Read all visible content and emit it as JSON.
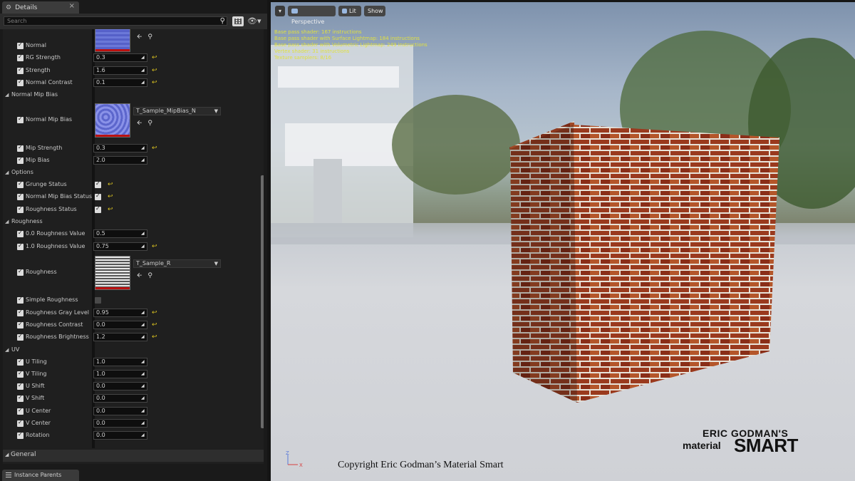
{
  "details_tab": {
    "label": "Details"
  },
  "search": {
    "placeholder": "Search"
  },
  "properties": [
    {
      "type": "texture",
      "name": "Normal",
      "checked": true
    },
    {
      "type": "number",
      "name": "RG Strength",
      "value": "0.3",
      "reset": true
    },
    {
      "type": "number",
      "name": "Strength",
      "value": "1.6",
      "reset": true
    },
    {
      "type": "number",
      "name": "Normal Contrast",
      "value": "0.1",
      "reset": true
    },
    {
      "type": "category",
      "name": "Normal Mip Bias"
    },
    {
      "type": "texture",
      "name": "Normal Mip Bias",
      "texture": "T_Sample_MipBias_N",
      "checked": true
    },
    {
      "type": "number",
      "name": "Mip Strength",
      "value": "0.3",
      "reset": true
    },
    {
      "type": "number",
      "name": "Mip Bias",
      "value": "2.0",
      "reset": false
    },
    {
      "type": "category",
      "name": "Options"
    },
    {
      "type": "bool",
      "name": "Grunge Status",
      "value": true,
      "reset": true
    },
    {
      "type": "bool",
      "name": "Normal Mip Bias Status",
      "value": true,
      "reset": true
    },
    {
      "type": "bool",
      "name": "Roughness Status",
      "value": true,
      "reset": true
    },
    {
      "type": "category",
      "name": "Roughness"
    },
    {
      "type": "number",
      "name": "0.0 Roughness Value",
      "value": "0.5",
      "reset": false
    },
    {
      "type": "number",
      "name": "1.0 Roughness Value",
      "value": "0.75",
      "reset": true
    },
    {
      "type": "texture",
      "name": "Roughness",
      "texture": "T_Sample_R",
      "checked": true
    },
    {
      "type": "bool",
      "name": "Simple Roughness",
      "value": false,
      "reset": false
    },
    {
      "type": "number",
      "name": "Roughness Gray Level",
      "value": "0.95",
      "reset": true
    },
    {
      "type": "number",
      "name": "Roughness Contrast",
      "value": "0.0",
      "reset": true
    },
    {
      "type": "number",
      "name": "Roughness Brightness",
      "value": "1.2",
      "reset": true
    },
    {
      "type": "category",
      "name": "UV"
    },
    {
      "type": "number",
      "name": "U Tiling",
      "value": "1.0",
      "reset": false
    },
    {
      "type": "number",
      "name": "V Tiling",
      "value": "1.0",
      "reset": false
    },
    {
      "type": "number",
      "name": "U Shift",
      "value": "0.0",
      "reset": false
    },
    {
      "type": "number",
      "name": "V Shift",
      "value": "0.0",
      "reset": false
    },
    {
      "type": "number",
      "name": "U Center",
      "value": "0.0",
      "reset": false
    },
    {
      "type": "number",
      "name": "V Center",
      "value": "0.0",
      "reset": false
    },
    {
      "type": "number",
      "name": "Rotation",
      "value": "0.0",
      "reset": false
    }
  ],
  "general_section": {
    "label": "General"
  },
  "bottom_tab": {
    "label": "Instance Parents"
  },
  "viewport": {
    "perspective_label": "Perspective",
    "lit_label": "Lit",
    "show_label": "Show",
    "stats": [
      "Base pass shader: 167 instructions",
      "Base pass shader with Surface Lightmap: 184 instructions",
      "Base pass shader with Volumetric Lightmap: 249 instructions",
      "Vertex shader: 31 instructions",
      "Texture samplers: 8/16"
    ],
    "axis_labels": {
      "z": "Z",
      "x": "X"
    }
  },
  "logo": {
    "line1": "ERIC GODMAN'S",
    "line2": "material",
    "line3": "SMART"
  },
  "copyright": "Copyright Eric Godman’s Material Smart",
  "colors": {
    "stats_text": "#e0e040",
    "reset_arrow": "#d8c020",
    "texture_border": "#b11111"
  }
}
